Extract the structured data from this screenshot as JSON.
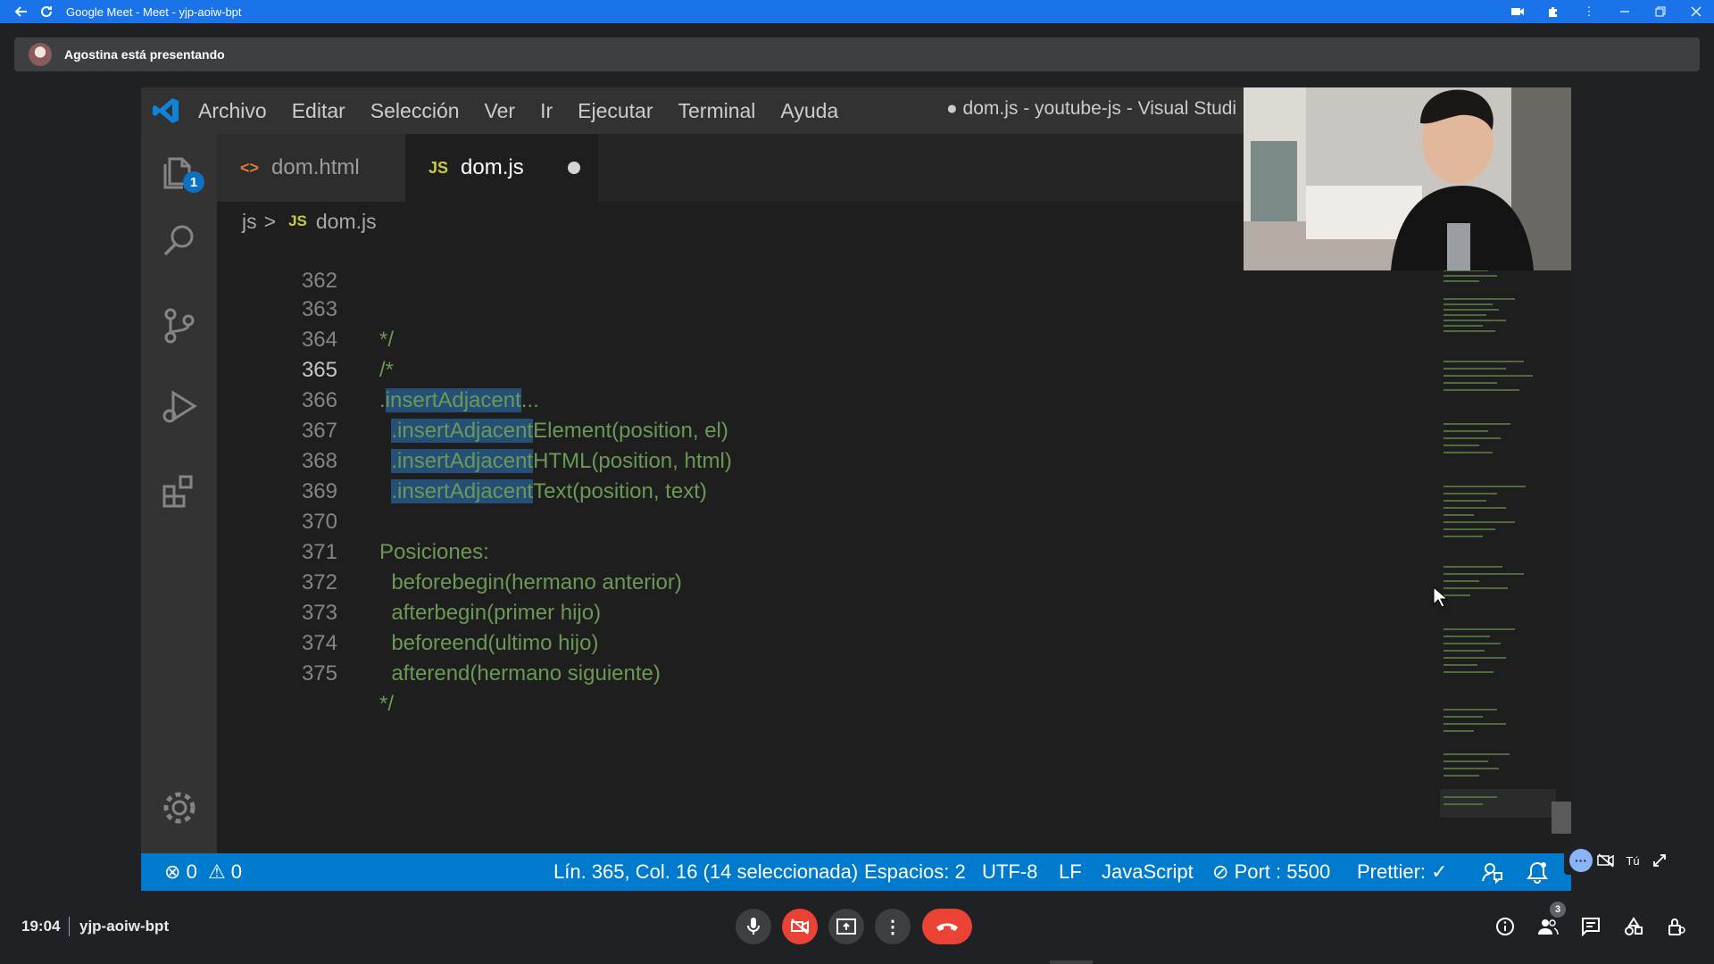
{
  "browser": {
    "window_title": "Google Meet - Meet - yjp-aoiw-bpt"
  },
  "presenting_banner": {
    "text": "Agostina está presentando"
  },
  "vscode": {
    "menu": [
      "Archivo",
      "Editar",
      "Selección",
      "Ver",
      "Ir",
      "Ejecutar",
      "Terminal",
      "Ayuda"
    ],
    "window_title": "● dom.js - youtube-js - Visual Studi",
    "explorer_badge": "1",
    "tabs": [
      {
        "icon": "<>",
        "label": "dom.html",
        "active": false
      },
      {
        "icon": "JS",
        "label": "dom.js",
        "active": true,
        "unsaved": true
      }
    ],
    "breadcrumb": {
      "folder": "js",
      "separator": ">",
      "file_icon": "JS",
      "file": "dom.js"
    },
    "lines": [
      {
        "n": "362",
        "text": ""
      },
      {
        "n": "363",
        "text": "*/"
      },
      {
        "n": "364",
        "text": "/*"
      },
      {
        "n": "365",
        "pre": ".",
        "sel": "insertAdjacent",
        "text": "..."
      },
      {
        "n": "366",
        "pre": "  ",
        "sel": ".insertAdjacent",
        "text": "Element(position, el)"
      },
      {
        "n": "367",
        "pre": "  ",
        "sel": ".insertAdjacent",
        "text": "HTML(position, html)"
      },
      {
        "n": "368",
        "pre": "  ",
        "sel": ".insertAdjacent",
        "text": "Text(position, text)"
      },
      {
        "n": "369",
        "text": ""
      },
      {
        "n": "370",
        "text": "Posiciones:"
      },
      {
        "n": "371",
        "text": "  beforebegin(hermano anterior)"
      },
      {
        "n": "372",
        "text": "  afterbegin(primer hijo)"
      },
      {
        "n": "373",
        "text": "  beforeend(ultimo hijo)"
      },
      {
        "n": "374",
        "text": "  afterend(hermano siguiente)"
      },
      {
        "n": "375",
        "text": "*/"
      }
    ],
    "status": {
      "errors": "0",
      "warnings": "0",
      "position": "Lín. 365, Col. 16 (14 seleccionada)",
      "spaces": "Espacios: 2",
      "encoding": "UTF-8",
      "eol": "LF",
      "language": "JavaScript",
      "port": "Port : 5500",
      "prettier": "Prettier: ✓"
    }
  },
  "self_view": {
    "label": "Tú"
  },
  "bottom_bar": {
    "time": "19:04",
    "meeting_code": "yjp-aoiw-bpt",
    "participants_count": "3"
  },
  "colors": {
    "meet_blue": "#1a73e8",
    "vscode_status": "#007acc",
    "comment_green": "#6a9955",
    "selection": "#264f78",
    "hangup_red": "#ea4335"
  }
}
